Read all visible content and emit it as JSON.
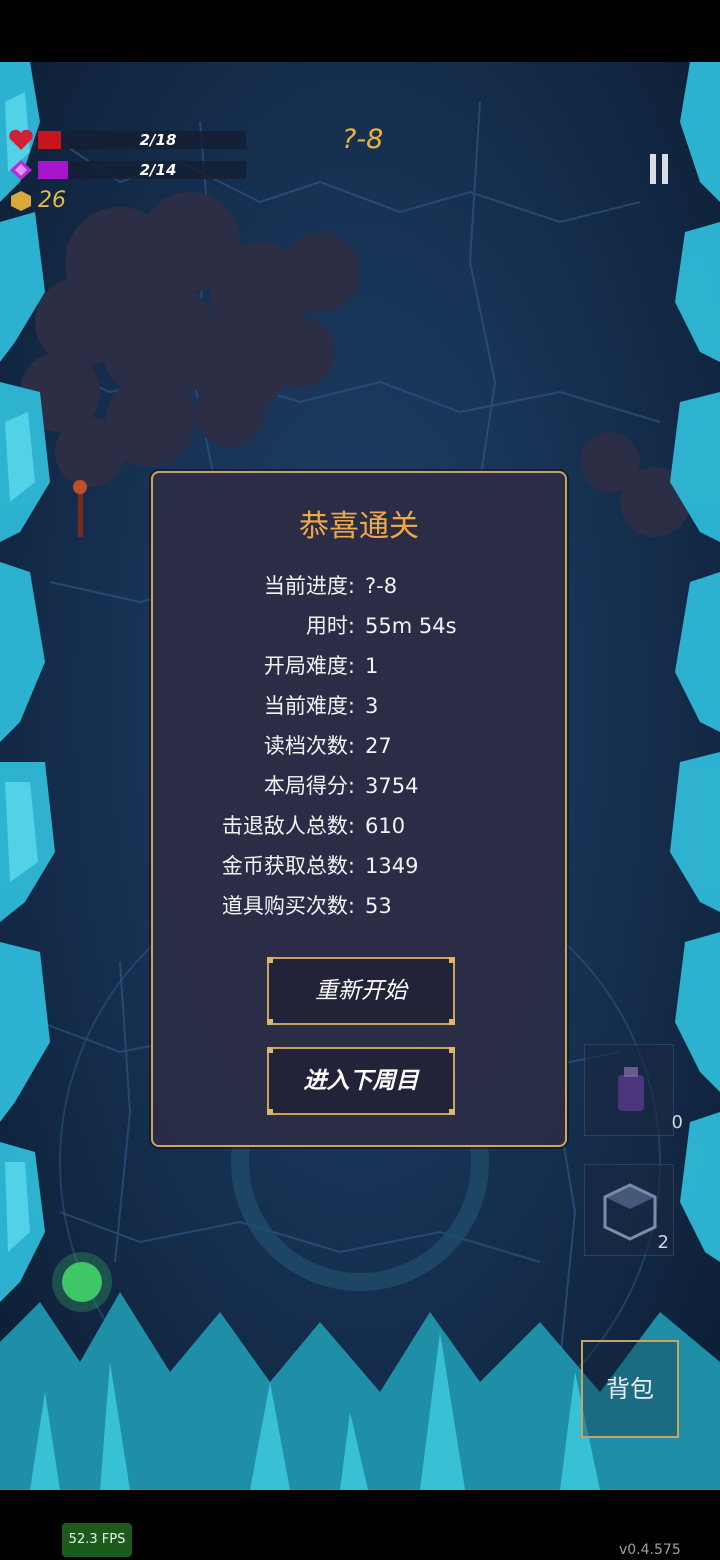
{
  "hud": {
    "hp_text": "2/18",
    "hp_fraction": 0.111,
    "mp_text": "2/14",
    "mp_fraction": 0.143,
    "coins": "26",
    "stage": "?-8"
  },
  "modal": {
    "title": "恭喜通关",
    "stats": [
      {
        "label": "当前进度:",
        "value": "?-8"
      },
      {
        "label": "用时:",
        "value": "55m 54s"
      },
      {
        "label": "开局难度:",
        "value": "1"
      },
      {
        "label": "当前难度:",
        "value": "3"
      },
      {
        "label": "读档次数:",
        "value": "27"
      },
      {
        "label": "本局得分:",
        "value": "3754"
      },
      {
        "label": "击退敌人总数:",
        "value": "610"
      },
      {
        "label": "金币获取总数:",
        "value": "1349"
      },
      {
        "label": "道具购买次数:",
        "value": "53"
      }
    ],
    "restart_label": "重新开始",
    "next_cycle_label": "进入下周目"
  },
  "inventory": {
    "slot1_count": "0",
    "slot2_count": "2",
    "bag_label": "背包"
  },
  "fps": "52.3 FPS",
  "version": "v0.4.575",
  "colors": {
    "hp": "#c8141c",
    "mp": "#a616c8",
    "gold": "#e8b43a",
    "modal_border": "#c9a45a"
  }
}
